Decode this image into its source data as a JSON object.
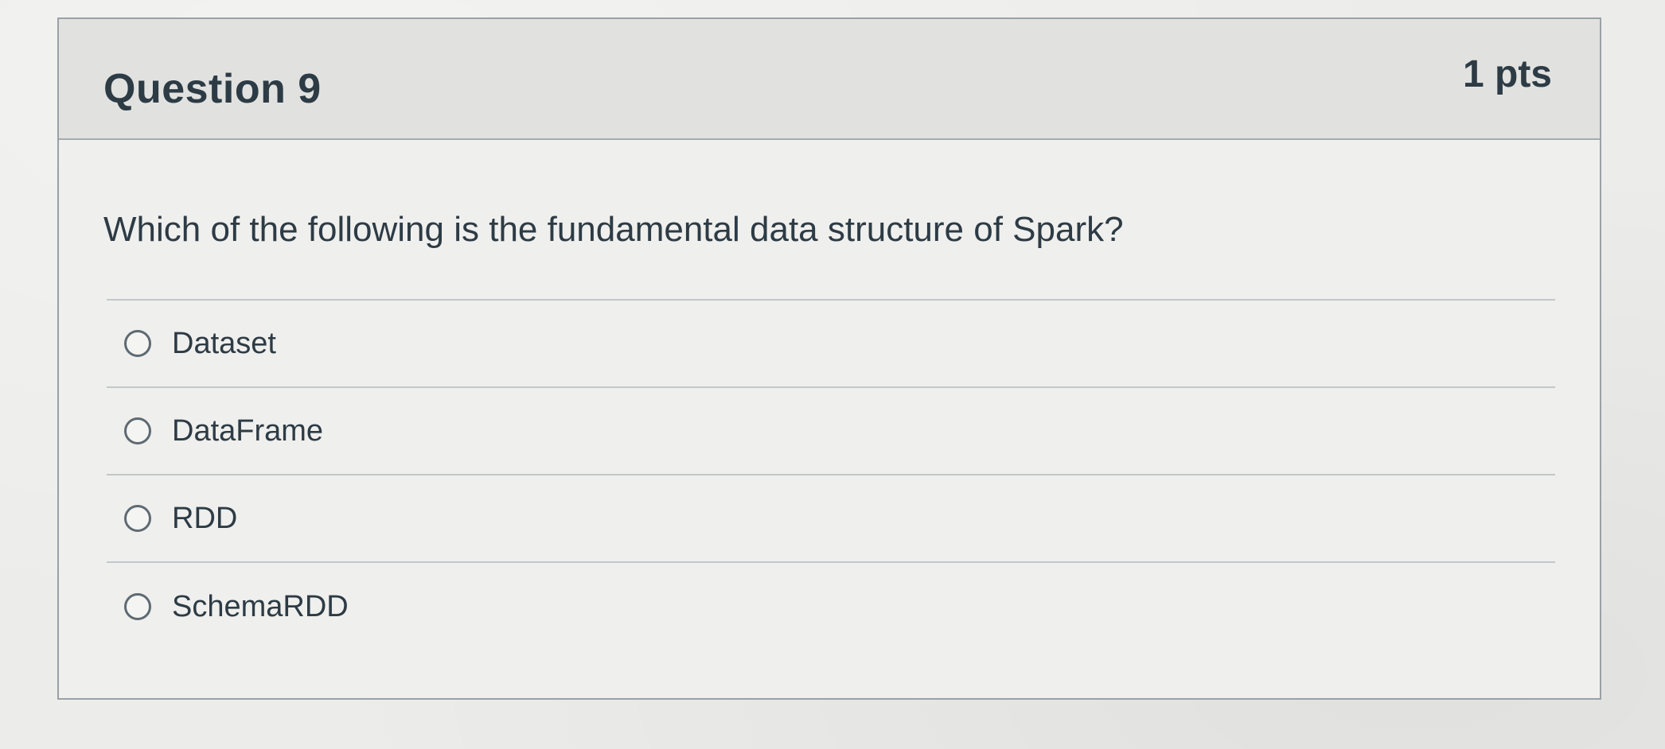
{
  "question": {
    "title": "Question 9",
    "points": "1 pts",
    "text": "Which of the following is the fundamental data structure of Spark?",
    "answers": [
      {
        "label": "Dataset",
        "selected": false
      },
      {
        "label": "DataFrame",
        "selected": false
      },
      {
        "label": "RDD",
        "selected": false
      },
      {
        "label": "SchemaRDD",
        "selected": false
      }
    ]
  }
}
